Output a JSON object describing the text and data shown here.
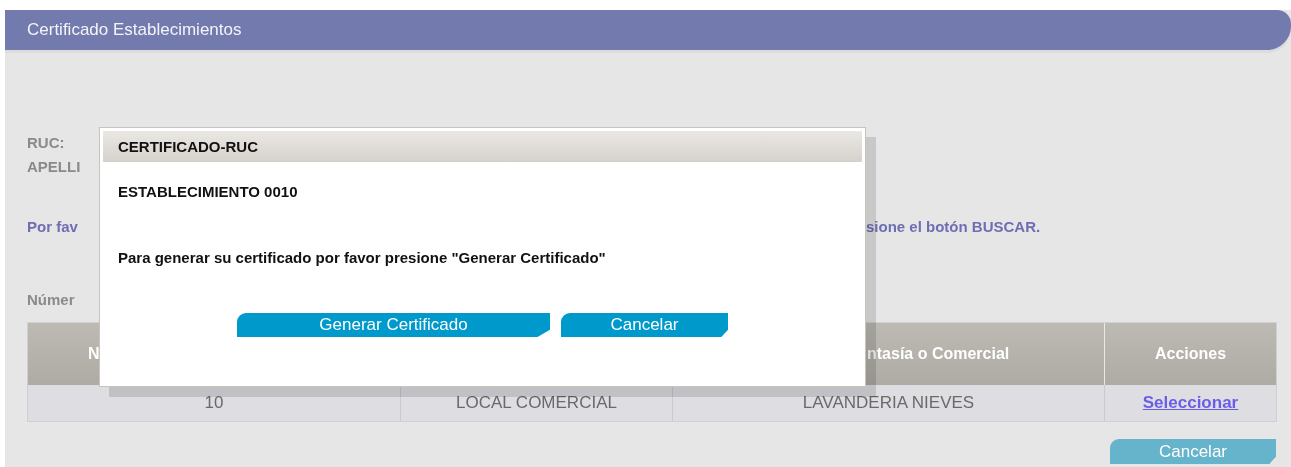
{
  "header": {
    "title": "Certificado Establecimientos"
  },
  "form": {
    "labels": [
      "RUC:",
      "APELLI"
    ]
  },
  "instructions": [
    "Por fav",
    "sione el botón BUSCAR."
  ],
  "section_label": "Númer",
  "table": {
    "columns": [
      {
        "kind": "text",
        "label": "N"
      },
      {
        "kind": "blank"
      },
      {
        "kind": "text",
        "label": "ntasía o Comercial"
      },
      {
        "kind": "text",
        "label": "Acciones"
      }
    ],
    "rows": [
      {
        "cells": [
          "10",
          "LOCAL COMERCIAL",
          "LAVANDERIA NIEVES"
        ],
        "action": "Seleccionar"
      }
    ]
  },
  "footer_button": "Cancelar",
  "dialog": {
    "title": "CERTIFICADO-RUC",
    "subtitle": "ESTABLECIMIENTO 0010",
    "message": "Para generar su certificado por favor presione \"Generar Certificado\"",
    "buttons": [
      "Generar Certificado",
      "Cancelar"
    ]
  }
}
